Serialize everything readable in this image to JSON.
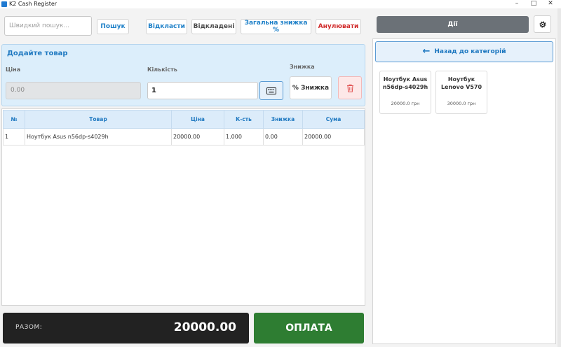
{
  "window": {
    "title": "K2 Cash Register",
    "controls": {
      "minimize": "–",
      "maximize": "□",
      "close": "✕"
    }
  },
  "toolbar": {
    "search_placeholder": "Швидкий пошук...",
    "search_label": "Пошук",
    "postpone_label": "Відкласти",
    "postponed_label": "Відкладені",
    "total_discount_label": "Загальна знижка %",
    "cancel_label": "Анулювати"
  },
  "add_product": {
    "title": "Додайте товар",
    "price_label": "Ціна",
    "price_value": "0.00",
    "quantity_label": "Кількість",
    "quantity_value": "1",
    "discount_label": "Знижка",
    "discount_button": "% Знижка"
  },
  "table": {
    "columns": [
      "№",
      "Товар",
      "Ціна",
      "К-сть",
      "Знижка",
      "Сума"
    ],
    "rows": [
      [
        "1",
        "Ноутбук Asus n56dp-s4029h",
        "20000.00",
        "1.000",
        "0.00",
        "20000.00"
      ]
    ]
  },
  "totals": {
    "label": "РАЗОМ:",
    "value": "20000.00",
    "pay_label": "ОПЛАТА"
  },
  "right_panel": {
    "actions_label": "Дії",
    "back_label": "Назад до категорій",
    "products": [
      {
        "name": "Ноутбук Asus n56dp-s4029h",
        "price": "20000.0 грн"
      },
      {
        "name": "Ноутбук Lenovo V570",
        "price": "30000.0 грн"
      }
    ]
  },
  "colors": {
    "accent_blue": "#1e78c0",
    "pay_green": "#2e7d32",
    "cancel_red": "#d12c2c",
    "panel_blue": "#dceefb"
  }
}
